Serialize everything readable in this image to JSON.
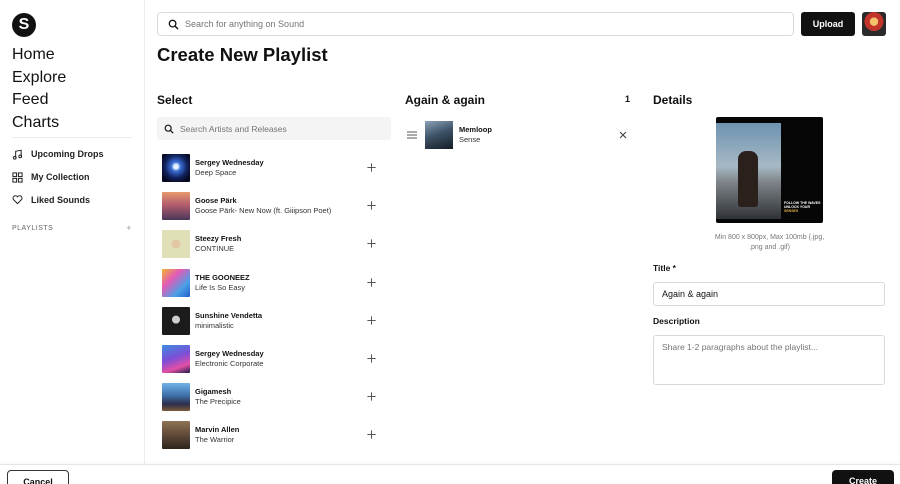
{
  "app": {
    "logo_letter": "S"
  },
  "sidebar": {
    "nav": [
      {
        "label": "Home",
        "name": "nav-home"
      },
      {
        "label": "Explore",
        "name": "nav-explore"
      },
      {
        "label": "Feed",
        "name": "nav-feed"
      },
      {
        "label": "Charts",
        "name": "nav-charts"
      }
    ],
    "links": [
      {
        "label": "Upcoming Drops",
        "icon": "music-note-icon"
      },
      {
        "label": "My Collection",
        "icon": "grid-icon"
      },
      {
        "label": "Liked Sounds",
        "icon": "heart-icon"
      }
    ],
    "playlists_label": "PLAYLISTS",
    "playlists_add": "+"
  },
  "header": {
    "search_placeholder": "Search for anything on Sound",
    "upload_label": "Upload"
  },
  "page": {
    "title": "Create New Playlist"
  },
  "select": {
    "heading": "Select",
    "search_placeholder": "Search Artists and Releases",
    "tracks": [
      {
        "artist": "Sergey Wednesday",
        "title": "Deep Space"
      },
      {
        "artist": "Goose Pärk",
        "title": "Goose Pärk- New Now (ft. Giiipson Poet)"
      },
      {
        "artist": "Steezy Fresh",
        "title": "CONTINUE"
      },
      {
        "artist": "THE GOONEEZ",
        "title": "Life Is So Easy"
      },
      {
        "artist": "Sunshine Vendetta",
        "title": "minimalistic"
      },
      {
        "artist": "Sergey Wednesday",
        "title": "Electronic Corporate"
      },
      {
        "artist": "Gigamesh",
        "title": "The Precipice"
      },
      {
        "artist": "Marvin Allen",
        "title": "The Warrior"
      }
    ]
  },
  "playlist": {
    "name": "Again & again",
    "count": "1",
    "items": [
      {
        "artist": "Memloop",
        "title": "Sense"
      }
    ]
  },
  "details": {
    "heading": "Details",
    "cover_text_line1": "FOLLOW THE WAVES",
    "cover_text_line2": "UNLOCK YOUR",
    "cover_text_accent": "SENSES",
    "cover_hint": "Min 800 x 800px, Max 100mb (.jpg, .png and .gif)",
    "title_label": "Title *",
    "title_value": "Again & again",
    "description_label": "Description",
    "description_placeholder": "Share 1-2 paragraphs about the playlist..."
  },
  "footer": {
    "cancel_label": "Cancel",
    "create_label": "Create"
  }
}
